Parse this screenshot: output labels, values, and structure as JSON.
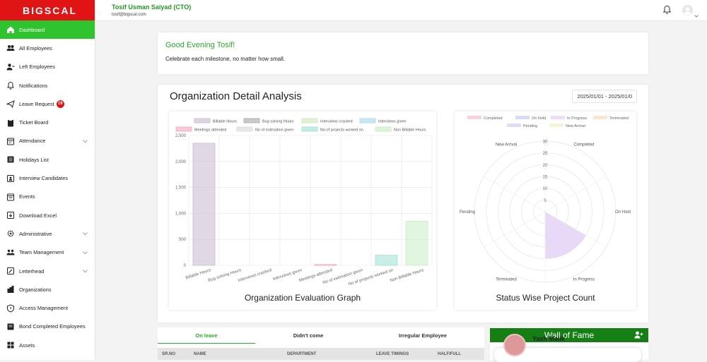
{
  "app": {
    "logo_text": "BIGSCAL"
  },
  "user": {
    "name": "Tosif Usman Saiyad (CTO)",
    "email": "tosif@bigscal.com"
  },
  "sidebar": {
    "items": [
      {
        "label": "Dashboard",
        "icon": "home-icon",
        "active": true
      },
      {
        "label": "All Employees",
        "icon": "users-icon"
      },
      {
        "label": "Left Employees",
        "icon": "user-minus-icon"
      },
      {
        "label": "Notifications",
        "icon": "bell-icon"
      },
      {
        "label": "Leave Request",
        "icon": "plane-icon",
        "badge": "19"
      },
      {
        "label": "Ticket Board",
        "icon": "clipboard-icon"
      },
      {
        "label": "Attendance",
        "icon": "calendar-icon",
        "expandable": true
      },
      {
        "label": "Holidays List",
        "icon": "list-icon"
      },
      {
        "label": "Interview Candidates",
        "icon": "id-card-icon"
      },
      {
        "label": "Events",
        "icon": "calendar-event-icon"
      },
      {
        "label": "Download Excel",
        "icon": "download-icon"
      },
      {
        "label": "Administrative",
        "icon": "gear-icon",
        "expandable": true
      },
      {
        "label": "Team Management",
        "icon": "team-icon",
        "expandable": true
      },
      {
        "label": "Letterhead",
        "icon": "pen-icon",
        "expandable": true
      },
      {
        "label": "Organizations",
        "icon": "building-icon"
      },
      {
        "label": "Access Management",
        "icon": "shield-icon"
      },
      {
        "label": "Bond Completed Employees",
        "icon": "document-icon"
      },
      {
        "label": "Assets",
        "icon": "grid-icon"
      }
    ]
  },
  "greeting": {
    "title": "Good Evening Tosif!",
    "subtitle": "Celebrate each milestone, no matter how small."
  },
  "analysis": {
    "title": "Organization Detail Analysis",
    "date_range": "2025/01/01 - 2025/01/0"
  },
  "chart_data": [
    {
      "type": "bar",
      "title": "Organization Evaluation Graph",
      "categories": [
        "Billable Hours",
        "Bug solving Hours",
        "Interviews cracked",
        "Interviews given",
        "Meetings attended",
        "No of estimation given",
        "No of projects worked on",
        "Non Billable Hours"
      ],
      "values": [
        2350,
        0,
        0,
        0,
        15,
        0,
        195,
        850
      ],
      "colors": [
        "#c9b8d0",
        "#a6a6aa",
        "#cde8b8",
        "#a8d8ea",
        "#f4a7b9",
        "#d8d8d8",
        "#9fe0d2",
        "#c6efc3"
      ],
      "yticks": [
        0,
        500,
        1000,
        1500,
        2000,
        2500
      ],
      "ytick_labels": [
        "0",
        "500",
        "1,000",
        "1,500",
        "2,000",
        "2,500"
      ],
      "ylim": [
        0,
        2500
      ],
      "legend": [
        "Billable Hours",
        "Bug solving Hours",
        "Interviews cracked",
        "Interviews given",
        "Meetings attended",
        "No of estimation given",
        "No of projects worked on",
        "Non Billable Hours"
      ],
      "grid": true,
      "legend_position": "top"
    },
    {
      "type": "polar-area",
      "title": "Status Wise Project Count",
      "categories": [
        "Completed",
        "On Hold",
        "In Progress",
        "Terminated",
        "Pending",
        "New Arrival"
      ],
      "values": [
        0,
        0,
        20,
        0,
        0,
        0
      ],
      "colors": [
        "#f6c9d0",
        "#cbd5f5",
        "#e7d5f7",
        "#fbe0c6",
        "#d9d4f5",
        "#f5f0cf"
      ],
      "rticks": [
        5,
        10,
        15,
        20,
        25,
        30
      ],
      "rlim": [
        0,
        30
      ],
      "legend": [
        "Completed",
        "On Hold",
        "In Progress",
        "Terminated",
        "Pending",
        "New Arrival"
      ],
      "legend_position": "top"
    }
  ],
  "tabs": [
    {
      "label": "On leave",
      "active": true
    },
    {
      "label": "Didn't come"
    },
    {
      "label": "Irregular Employee"
    }
  ],
  "table": {
    "headers": [
      "SR.NO",
      "NAME",
      "DEPARTMENT",
      "LEAVE TIMINGS",
      "HALF/FULL"
    ]
  },
  "wall_of_fame": {
    "title": "Wall of Fame",
    "person_name": "Yash Malik"
  },
  "colors": {
    "brand_red": "#e01414",
    "accent_green": "#2fc32f",
    "wall_green": "#157e15"
  }
}
